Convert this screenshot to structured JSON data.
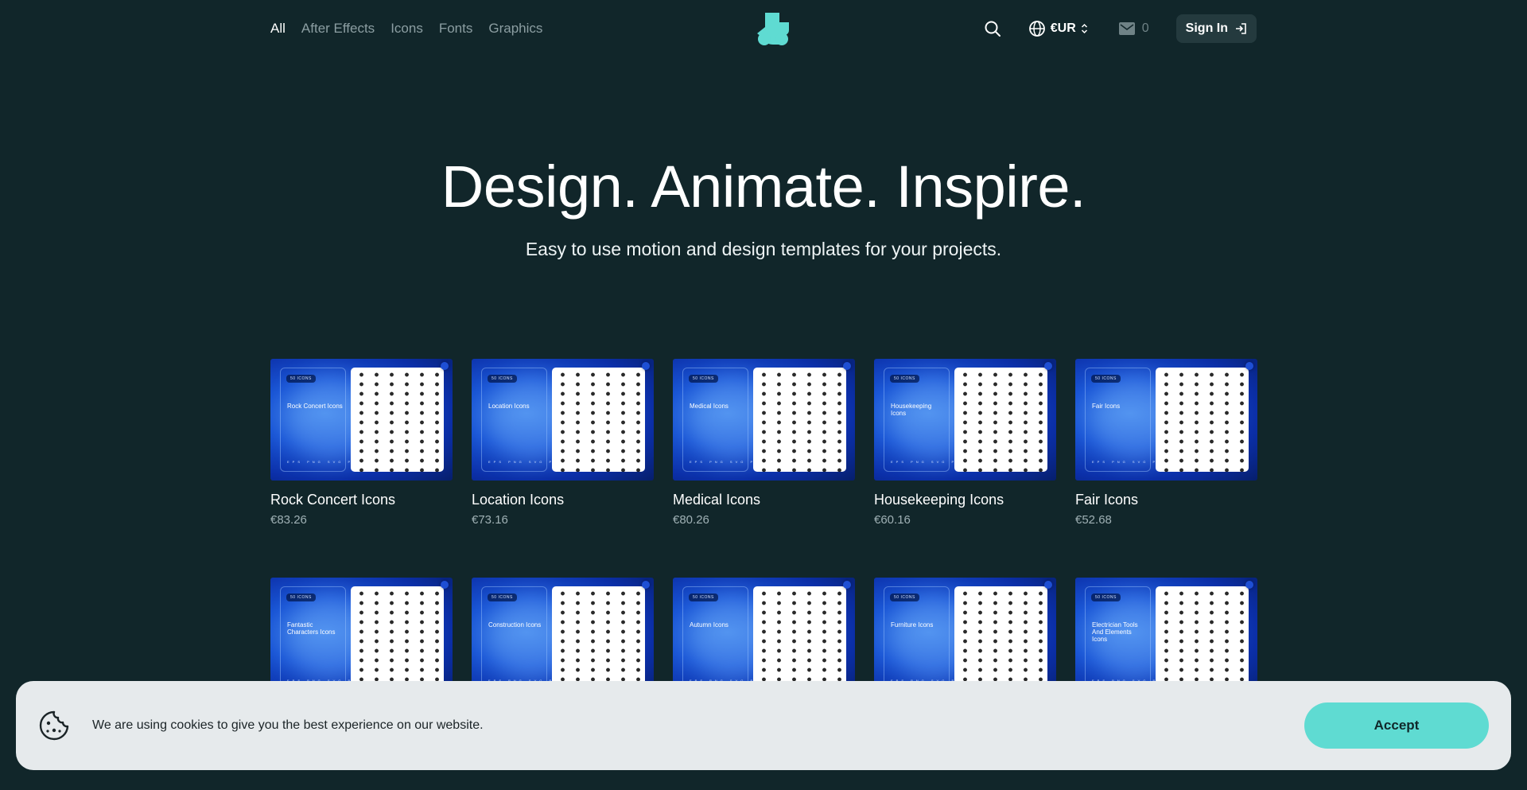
{
  "nav": {
    "items": [
      {
        "label": "All",
        "active": true
      },
      {
        "label": "After Effects",
        "active": false
      },
      {
        "label": "Icons",
        "active": false
      },
      {
        "label": "Fonts",
        "active": false
      },
      {
        "label": "Graphics",
        "active": false
      }
    ]
  },
  "header": {
    "logo_icon": "brand-logo-icon",
    "search_icon": "search-icon",
    "currency_label": "€UR",
    "cart_count": "0",
    "signin_label": "Sign In",
    "accent_color": "#5fdbd2"
  },
  "hero": {
    "title": "Design. Animate. Inspire.",
    "subtitle": "Easy to use motion and design templates for your projects."
  },
  "products": [
    {
      "name": "Rock Concert Icons",
      "price": "€83.26",
      "thumb_title": "Rock Concert Icons"
    },
    {
      "name": "Location Icons",
      "price": "€73.16",
      "thumb_title": "Location Icons"
    },
    {
      "name": "Medical Icons",
      "price": "€80.26",
      "thumb_title": "Medical Icons"
    },
    {
      "name": "Housekeeping Icons",
      "price": "€60.16",
      "thumb_title": "Housekeeping Icons"
    },
    {
      "name": "Fair Icons",
      "price": "€52.68",
      "thumb_title": "Fair Icons"
    },
    {
      "name": "",
      "price": "",
      "thumb_title": "Fantastic Characters Icons"
    },
    {
      "name": "",
      "price": "",
      "thumb_title": "Construction Icons"
    },
    {
      "name": "",
      "price": "",
      "thumb_title": "Autumn Icons"
    },
    {
      "name": "",
      "price": "",
      "thumb_title": "Furniture Icons"
    },
    {
      "name": "",
      "price": "",
      "thumb_title": "Electrician Tools And Elements Icons"
    }
  ],
  "thumb": {
    "badge": "50 ICONS",
    "formats": "EPS PNG SVG PSD"
  },
  "cookie": {
    "text": "We are using cookies to give you the best experience on our website.",
    "accept_label": "Accept",
    "icon": "cookie-icon"
  }
}
